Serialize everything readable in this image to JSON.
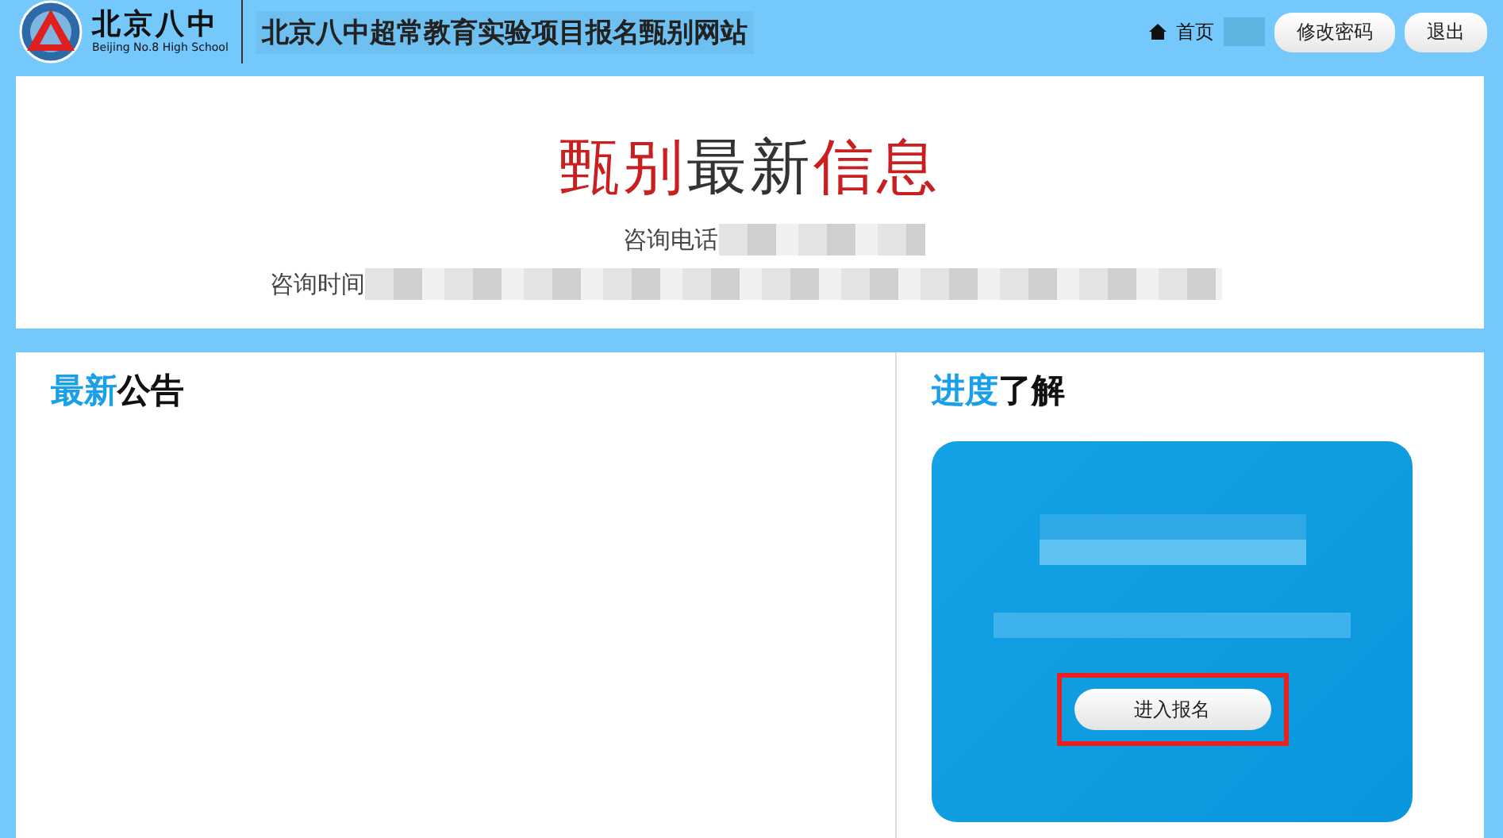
{
  "header": {
    "logo_name": "北京八中",
    "logo_subtitle": "Beijing No.8 High School",
    "site_title": "北京八中超常教育实验项目报名甄别网站",
    "home_link": "首页",
    "buttons": [
      "修改密码",
      "退出"
    ]
  },
  "banner": {
    "title": [
      {
        "text": "甄别",
        "accent": true
      },
      {
        "text": "最新",
        "accent": false
      },
      {
        "text": "信息",
        "accent": true
      }
    ],
    "lines": [
      {
        "label": "咨询电话",
        "redacted": true
      },
      {
        "label": "咨询时间",
        "redacted": true
      }
    ]
  },
  "notices": {
    "title": [
      {
        "text": "最新",
        "accent": true
      },
      {
        "text": "公告",
        "accent": false
      }
    ]
  },
  "progress": {
    "title": [
      {
        "text": "进度",
        "accent": true
      },
      {
        "text": "了解",
        "accent": false
      }
    ],
    "button": "进入报名",
    "highlighted": true
  }
}
